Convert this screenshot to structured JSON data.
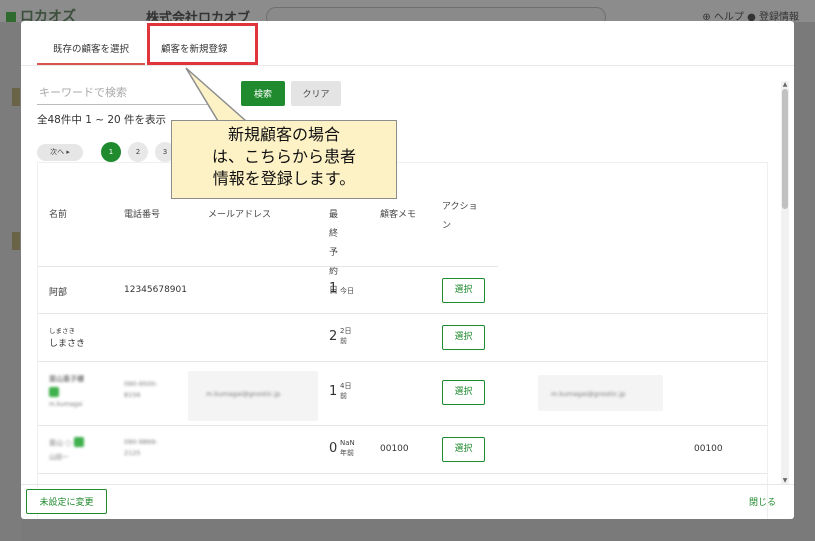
{
  "background": {
    "logo": "ロカオズ",
    "company": "株式会社ロカオブ",
    "right_text": "⊕ ヘルプ ● 登録情報"
  },
  "tabs": [
    {
      "label": "既存の顧客を選択",
      "active": true
    },
    {
      "label": "顧客を新規登録",
      "active": false
    }
  ],
  "search": {
    "placeholder": "キーワードで検索",
    "search_label": "検索",
    "clear_label": "クリア"
  },
  "result_count": "全48件中 1 ~ 20 件を表示",
  "pagination": {
    "next_label": "次へ ▸",
    "pages": [
      "1",
      "2",
      "3"
    ]
  },
  "table": {
    "headers": {
      "name": "名前",
      "phone": "電話番号",
      "email": "メールアドレス",
      "last_visit": "最終予約日",
      "memo": "顧客メモ",
      "action": "アクション"
    },
    "rows": [
      {
        "name": "阿部",
        "phone": "12345678901",
        "days": "1",
        "unit": "今日",
        "select": "選択"
      },
      {
        "kana": "しまさき",
        "name": "しまさき",
        "days": "2",
        "unit": "2日前",
        "select": "選択"
      },
      {
        "name": "苗山直子様",
        "sub": "m.kumagai",
        "phone": "090-9500-8156",
        "email": "m.kumagai@gnostic.jp",
        "days": "1",
        "unit": "4日前",
        "select": "選択",
        "extra": "m.kumagai@gnostic.jp"
      },
      {
        "name": "苗山 ○ 子",
        "sub": "山田一",
        "phone": "090-9869-2125",
        "days": "0",
        "unit": "NaN年前",
        "memo": "00100",
        "select": "選択",
        "extra": "00100"
      }
    ]
  },
  "footer": {
    "unset_label": "未設定に変更",
    "close_label": "閉じる"
  },
  "callout": {
    "lines": [
      "新規顧客の場合",
      "は、こちらから患者",
      "情報を登録します。"
    ]
  },
  "colors": {
    "accent": "#1f8a2e",
    "tab_underline": "#d9534f",
    "highlight_box": "#e0353a",
    "callout_bg": "#fdf1c6"
  }
}
